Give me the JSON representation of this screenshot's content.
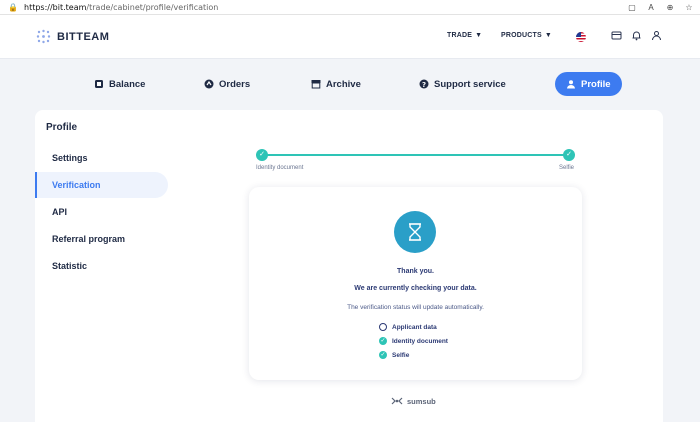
{
  "browser": {
    "url_host": "https://bit.team",
    "url_path": "/trade/cabinet/profile/verification"
  },
  "header": {
    "logo_text": "BITTEAM",
    "nav": [
      {
        "label": "TRADE"
      },
      {
        "label": "PRODUCTS"
      }
    ]
  },
  "tabs": [
    {
      "label": "Balance"
    },
    {
      "label": "Orders"
    },
    {
      "label": "Archive"
    },
    {
      "label": "Support service"
    },
    {
      "label": "Profile"
    }
  ],
  "profile": {
    "title": "Profile",
    "sidebar": [
      {
        "label": "Settings"
      },
      {
        "label": "Verification"
      },
      {
        "label": "API"
      },
      {
        "label": "Referral program"
      },
      {
        "label": "Statistic"
      }
    ]
  },
  "stepper": {
    "steps": [
      {
        "label": "Identity document"
      },
      {
        "label": "Selfie"
      }
    ]
  },
  "verification": {
    "thank_you": "Thank you.",
    "checking": "We are currently checking your data.",
    "status_note": "The verification status will update automatically.",
    "checklist": [
      {
        "label": "Applicant data",
        "done": false
      },
      {
        "label": "Identity document",
        "done": true
      },
      {
        "label": "Selfie",
        "done": true
      }
    ]
  },
  "footer": {
    "brand": "sumsub"
  },
  "colors": {
    "accent": "#3d7bf0",
    "success": "#2ec4b6",
    "hourglass_bg": "#2a9fc8"
  }
}
